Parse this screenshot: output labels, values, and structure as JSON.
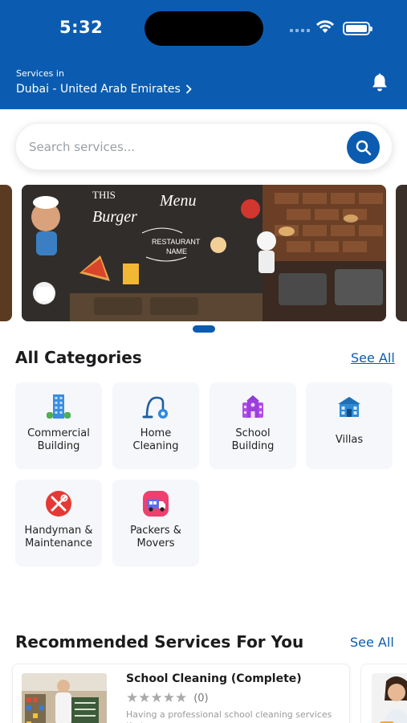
{
  "status_bar": {
    "time": "5:32"
  },
  "header": {
    "location_label": "Services in",
    "location_value": "Dubai - United Arab Emirates",
    "background_color": "#0b5cb0"
  },
  "search": {
    "placeholder": "Search services...",
    "value": ""
  },
  "banner": {
    "text_this": "THIS",
    "text_burger": "Burger",
    "text_menu": "Menu",
    "text_restaurant": "RESTAURANT",
    "text_name": "NAME",
    "active_index": 1
  },
  "categories_section": {
    "title": "All Categories",
    "see_all": "See All",
    "items": [
      {
        "label_line1": "Commercial",
        "label_line2": "Building",
        "icon": "office-building-icon"
      },
      {
        "label_line1": "Home",
        "label_line2": "Cleaning",
        "icon": "vacuum-cleaner-icon"
      },
      {
        "label_line1": "School",
        "label_line2": "Building",
        "icon": "school-building-icon"
      },
      {
        "label_line1": "Villas",
        "label_line2": "",
        "icon": "villa-house-icon"
      },
      {
        "label_line1": "Handyman &",
        "label_line2": "Maintenance",
        "icon": "tools-icon"
      },
      {
        "label_line1": "Packers &",
        "label_line2": "Movers",
        "icon": "moving-truck-icon"
      }
    ]
  },
  "recommended_section": {
    "title": "Recommended Services For You",
    "see_all": "See All",
    "cards": [
      {
        "title": "School Cleaning (Complete)",
        "rating_stars": "★★★★★",
        "rating_count": "(0)",
        "description": "Having a professional school cleaning services that"
      }
    ]
  },
  "colors": {
    "primary": "#0b5cb0",
    "card_bg": "#f5f7fa",
    "star_empty": "#a9a9a9"
  }
}
